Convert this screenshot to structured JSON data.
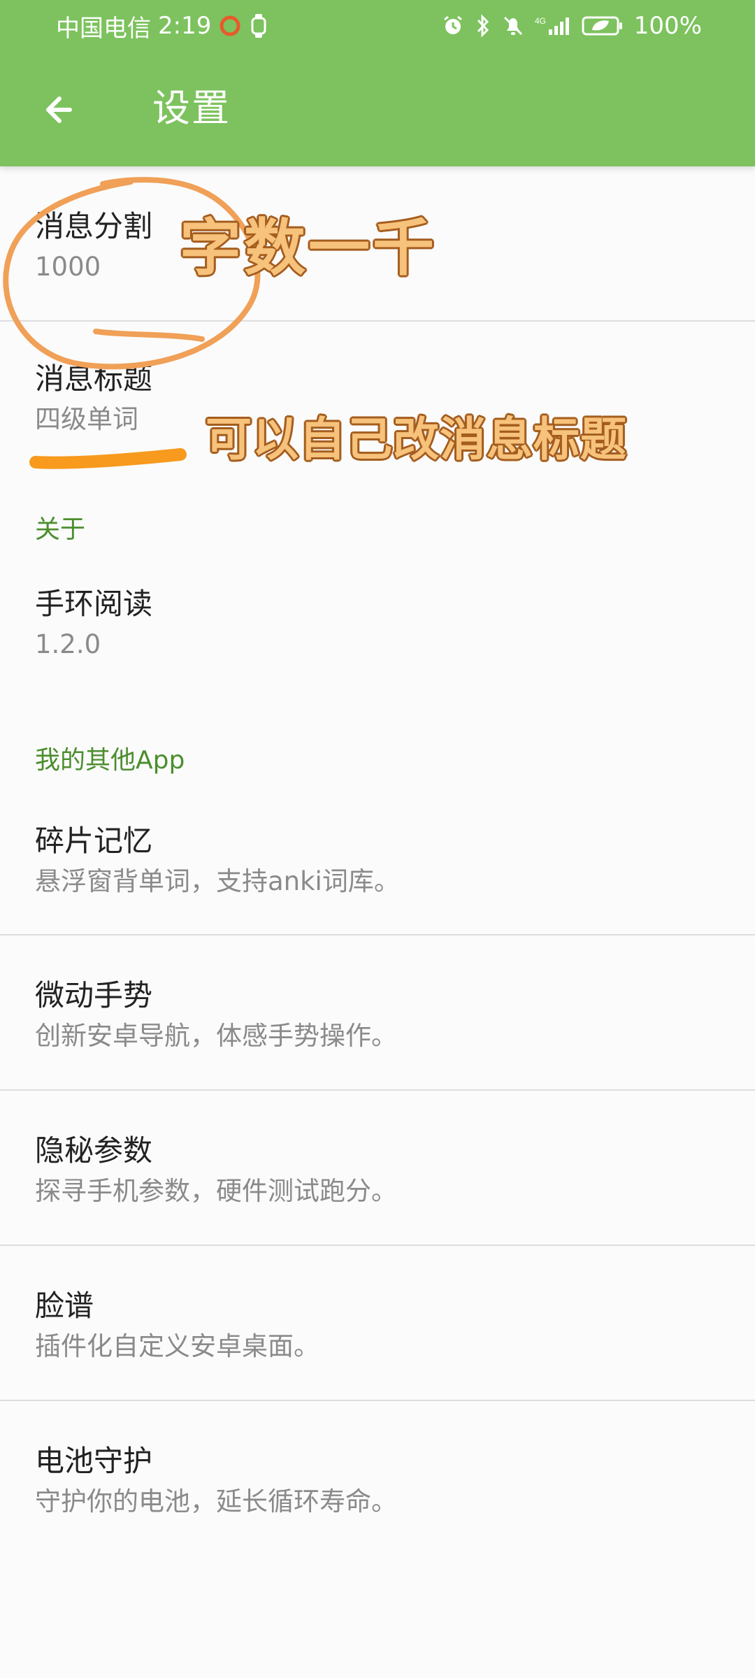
{
  "status_bar": {
    "carrier": "中国电信",
    "time": "2:19",
    "battery_text": "100%",
    "left_icons": [
      "red-circle-icon",
      "watch-icon"
    ],
    "right_icons": [
      "alarm-icon",
      "bluetooth-icon",
      "bell-off-icon",
      "signal-4g-icon",
      "battery-leaf-icon"
    ],
    "network_label": "4G"
  },
  "toolbar": {
    "title": "设置",
    "back_icon": "arrow-left-icon"
  },
  "settings": [
    {
      "title": "消息分割",
      "summary": "1000"
    },
    {
      "title": "消息标题",
      "summary": "四级单词"
    }
  ],
  "about": {
    "header": "关于",
    "items": [
      {
        "title": "手环阅读",
        "summary": "1.2.0"
      }
    ]
  },
  "other_apps": {
    "header": "我的其他App",
    "items": [
      {
        "title": "碎片记忆",
        "summary": "悬浮窗背单词，支持anki词库。"
      },
      {
        "title": "微动手势",
        "summary": "创新安卓导航，体感手势操作。"
      },
      {
        "title": "隐秘参数",
        "summary": "探寻手机参数，硬件测试跑分。"
      },
      {
        "title": "脸谱",
        "summary": "插件化自定义安卓桌面。"
      },
      {
        "title": "电池守护",
        "summary": "守护你的电池，延长循环寿命。"
      }
    ]
  },
  "annotations": {
    "note_1": "字数一千",
    "note_2": "可以自己改消息标题",
    "colors": {
      "stroke": "#f0a057",
      "underline": "#f79a1d",
      "text_fill": "#f7c27b",
      "text_outline": "#a45d1e"
    }
  },
  "colors": {
    "toolbar": "#7dc25e",
    "section_header": "#4b8e2e",
    "background": "#fbfbfb",
    "divider": "#dddddd"
  }
}
